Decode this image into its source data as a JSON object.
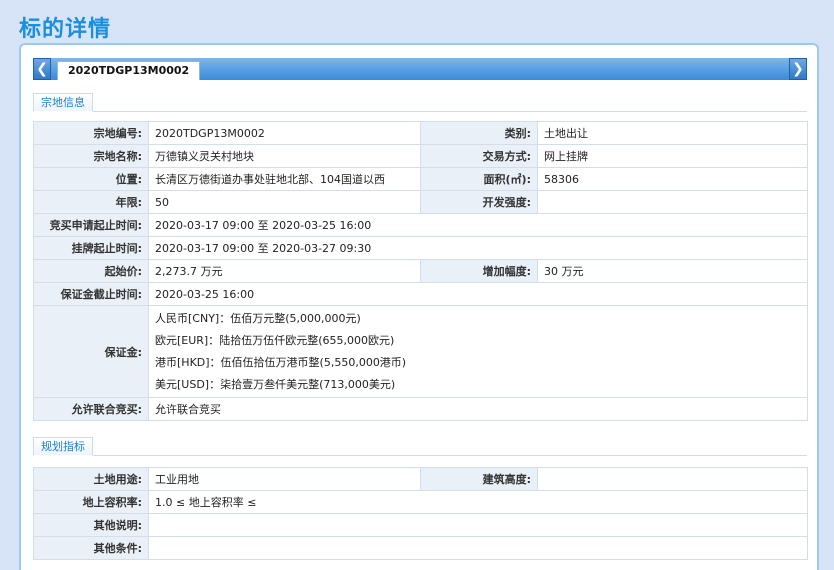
{
  "page": {
    "title": "标的详情"
  },
  "tabs": [
    {
      "label": "2020TDGP13M0002"
    }
  ],
  "section_parcel": {
    "title": "宗地信息",
    "parcel_no_label": "宗地编号:",
    "parcel_no": "2020TDGP13M0002",
    "category_label": "类别:",
    "category": "土地出让",
    "parcel_name_label": "宗地名称:",
    "parcel_name": "万德镇义灵关村地块",
    "trade_method_label": "交易方式:",
    "trade_method": "网上挂牌",
    "location_label": "位置:",
    "location": "长清区万德街道办事处驻地北部、104国道以西",
    "area_label": "面积(㎡):",
    "area": "58306",
    "term_label": "年限:",
    "term": "50",
    "dev_intensity_label": "开发强度:",
    "dev_intensity": "",
    "bid_apply_period_label": "竞买申请起止时间:",
    "bid_apply_period": "2020-03-17 09:00 至 2020-03-25 16:00",
    "listing_period_label": "挂牌起止时间:",
    "listing_period": "2020-03-17 09:00 至 2020-03-27 09:30",
    "start_price_label": "起始价:",
    "start_price": "2,273.7 万元",
    "increment_label": "增加幅度:",
    "increment": "30 万元",
    "deposit_deadline_label": "保证金截止时间:",
    "deposit_deadline": "2020-03-25 16:00",
    "deposit_label": "保证金:",
    "deposit_lines": [
      "人民币[CNY]：伍佰万元整(5,000,000元)",
      "欧元[EUR]：陆拾伍万伍仟欧元整(655,000欧元)",
      "港币[HKD]：伍佰伍拾伍万港币整(5,550,000港币)",
      "美元[USD]：柒拾壹万叁仟美元整(713,000美元)"
    ],
    "joint_bid_label": "允许联合竞买:",
    "joint_bid": "允许联合竞买"
  },
  "section_planning": {
    "title": "规划指标",
    "land_use_label": "土地用途:",
    "land_use": "工业用地",
    "building_height_label": "建筑高度:",
    "building_height": "",
    "plot_ratio_label": "地上容积率:",
    "plot_ratio": "1.0 ≤ 地上容积率 ≤",
    "other_notes_label": "其他说明:",
    "other_notes": "",
    "other_conditions_label": "其他条件:",
    "other_conditions": ""
  },
  "colors": {
    "title": "#1a8fe0",
    "tabbar": "#3a8ad8",
    "label_bg": "#eaf0f7",
    "background": "#d7e3f6"
  }
}
